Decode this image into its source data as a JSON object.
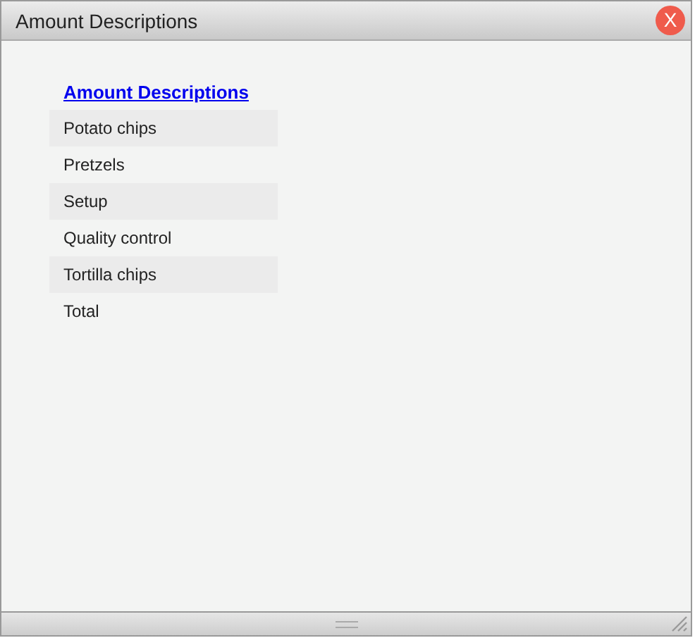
{
  "window": {
    "title": "Amount Descriptions",
    "close_label": "X"
  },
  "heading_link": "Amount Descriptions",
  "items": [
    {
      "label": "Potato chips"
    },
    {
      "label": "Pretzels"
    },
    {
      "label": "Setup"
    },
    {
      "label": "Quality control"
    },
    {
      "label": "Tortilla chips"
    },
    {
      "label": "Total"
    }
  ]
}
